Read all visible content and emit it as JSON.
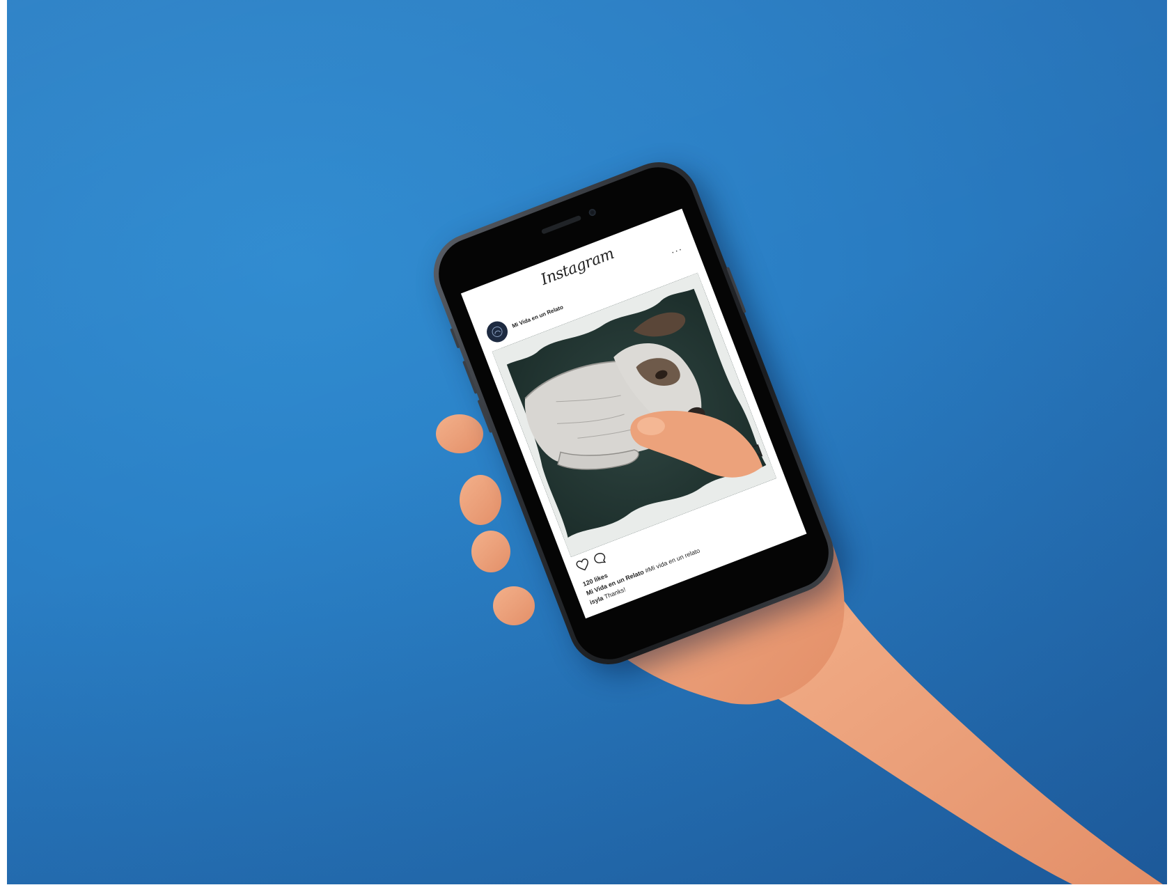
{
  "app": {
    "name": "Instagram"
  },
  "post": {
    "username": "Mi Vida en un Relato",
    "more_label": "···",
    "likes": "120 likes",
    "caption_user": "Mi Vida en un Relato",
    "caption_text": "#Mi vida en un relato",
    "comment_user": "isyla",
    "comment_text": "Thanks!"
  },
  "icons": {
    "like": "heart-icon",
    "comment": "comment-icon",
    "save": "bookmark-icon",
    "more": "more-options-icon"
  },
  "colors": {
    "background": "#2a7fc5",
    "phone_frame": "#1b1d20",
    "post_image_bg": "#1c302d",
    "skin": "#eda27c"
  }
}
